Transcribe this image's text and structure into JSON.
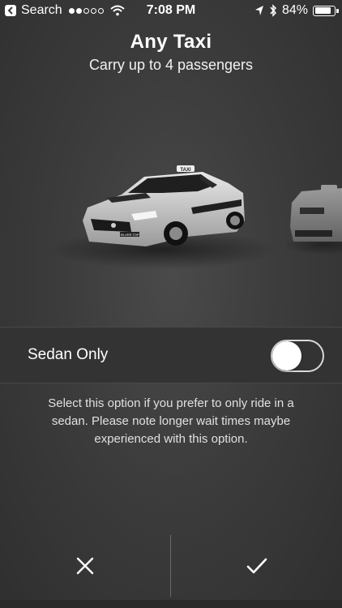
{
  "status_bar": {
    "back_label": "Search",
    "time": "7:08 PM",
    "battery": "84%",
    "battery_level": 0.84,
    "signal_bars_filled": 2,
    "signal_bars_total": 5
  },
  "header": {
    "title": "Any Taxi",
    "subtitle": "Carry up to 4 passengers"
  },
  "car": {
    "roof_sign": "TAXI",
    "brand_label": "SILVER TOP"
  },
  "option": {
    "label": "Sedan Only",
    "enabled": false
  },
  "description": "Select this option if you prefer to only ride in a sedan. Please note longer wait times maybe experienced with this option.",
  "actions": {
    "cancel_icon": "close-icon",
    "confirm_icon": "check-icon"
  }
}
